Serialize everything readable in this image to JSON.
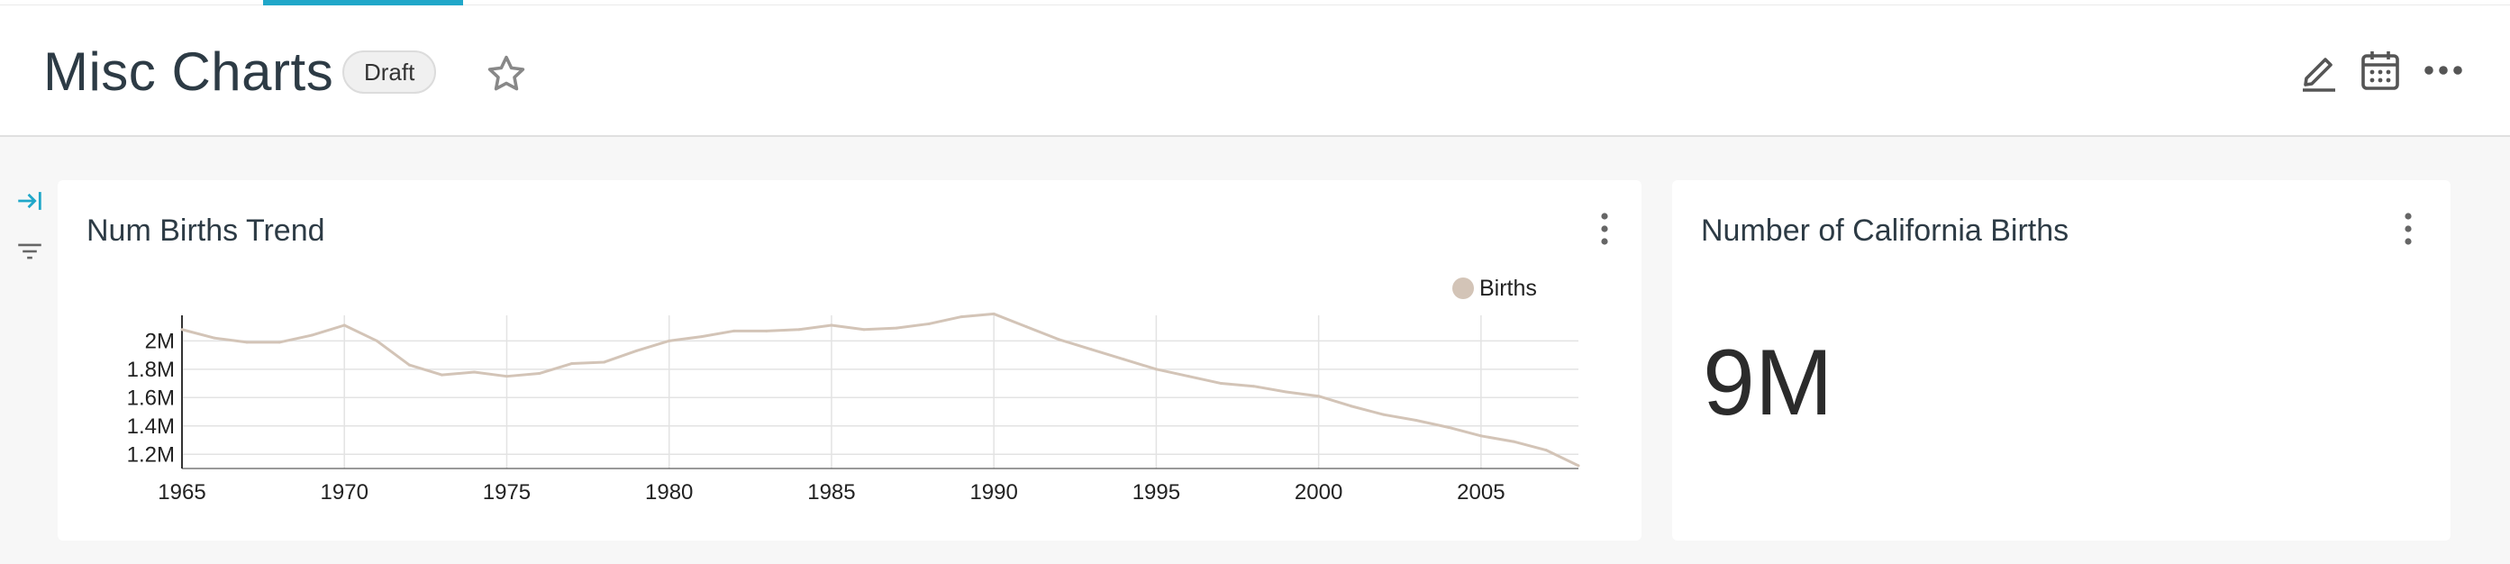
{
  "dashboard": {
    "title": "Misc Charts",
    "status_badge": "Draft"
  },
  "header_icons": [
    "star-icon",
    "pencil-icon",
    "calendar-icon",
    "more-horizontal-icon"
  ],
  "sidebar_icons": [
    "expand-panel-icon",
    "filter-icon"
  ],
  "accent_color": "#20a7c9",
  "charts": {
    "trend": {
      "title": "Num Births Trend"
    },
    "bignumber": {
      "title": "Number of California Births",
      "value": "9M"
    }
  },
  "chart_data": {
    "type": "line",
    "title": "Num Births Trend",
    "xlabel": "",
    "ylabel": "",
    "legend_position": "top-right",
    "series_color": "#d3c4b7",
    "grid": true,
    "xlim": [
      1965,
      2008
    ],
    "ylim": [
      1100000,
      2180000
    ],
    "x_ticks": [
      1965,
      1970,
      1975,
      1980,
      1985,
      1990,
      1995,
      2000,
      2005
    ],
    "x_tick_labels": [
      "1965",
      "1970",
      "1975",
      "1980",
      "1985",
      "1990",
      "1995",
      "2000",
      "2005"
    ],
    "y_ticks": [
      1200000,
      1400000,
      1600000,
      1800000,
      2000000
    ],
    "y_tick_labels": [
      "1.2M",
      "1.4M",
      "1.6M",
      "1.8M",
      "2M"
    ],
    "series": [
      {
        "name": "Births",
        "x": [
          1965,
          1966,
          1967,
          1968,
          1969,
          1970,
          1971,
          1972,
          1973,
          1974,
          1975,
          1976,
          1977,
          1978,
          1979,
          1980,
          1981,
          1982,
          1983,
          1984,
          1985,
          1986,
          1987,
          1988,
          1989,
          1990,
          1991,
          1992,
          1993,
          1994,
          1995,
          1996,
          1997,
          1998,
          1999,
          2000,
          2001,
          2002,
          2003,
          2004,
          2005,
          2006,
          2007,
          2008
        ],
        "values": [
          2080000,
          2020000,
          1990000,
          1990000,
          2040000,
          2110000,
          2000000,
          1830000,
          1760000,
          1780000,
          1750000,
          1770000,
          1840000,
          1850000,
          1930000,
          2000000,
          2030000,
          2070000,
          2070000,
          2080000,
          2110000,
          2080000,
          2090000,
          2120000,
          2170000,
          2190000,
          2100000,
          2010000,
          1940000,
          1870000,
          1800000,
          1750000,
          1700000,
          1680000,
          1640000,
          1610000,
          1540000,
          1480000,
          1440000,
          1390000,
          1330000,
          1290000,
          1230000,
          1120000
        ]
      }
    ]
  }
}
